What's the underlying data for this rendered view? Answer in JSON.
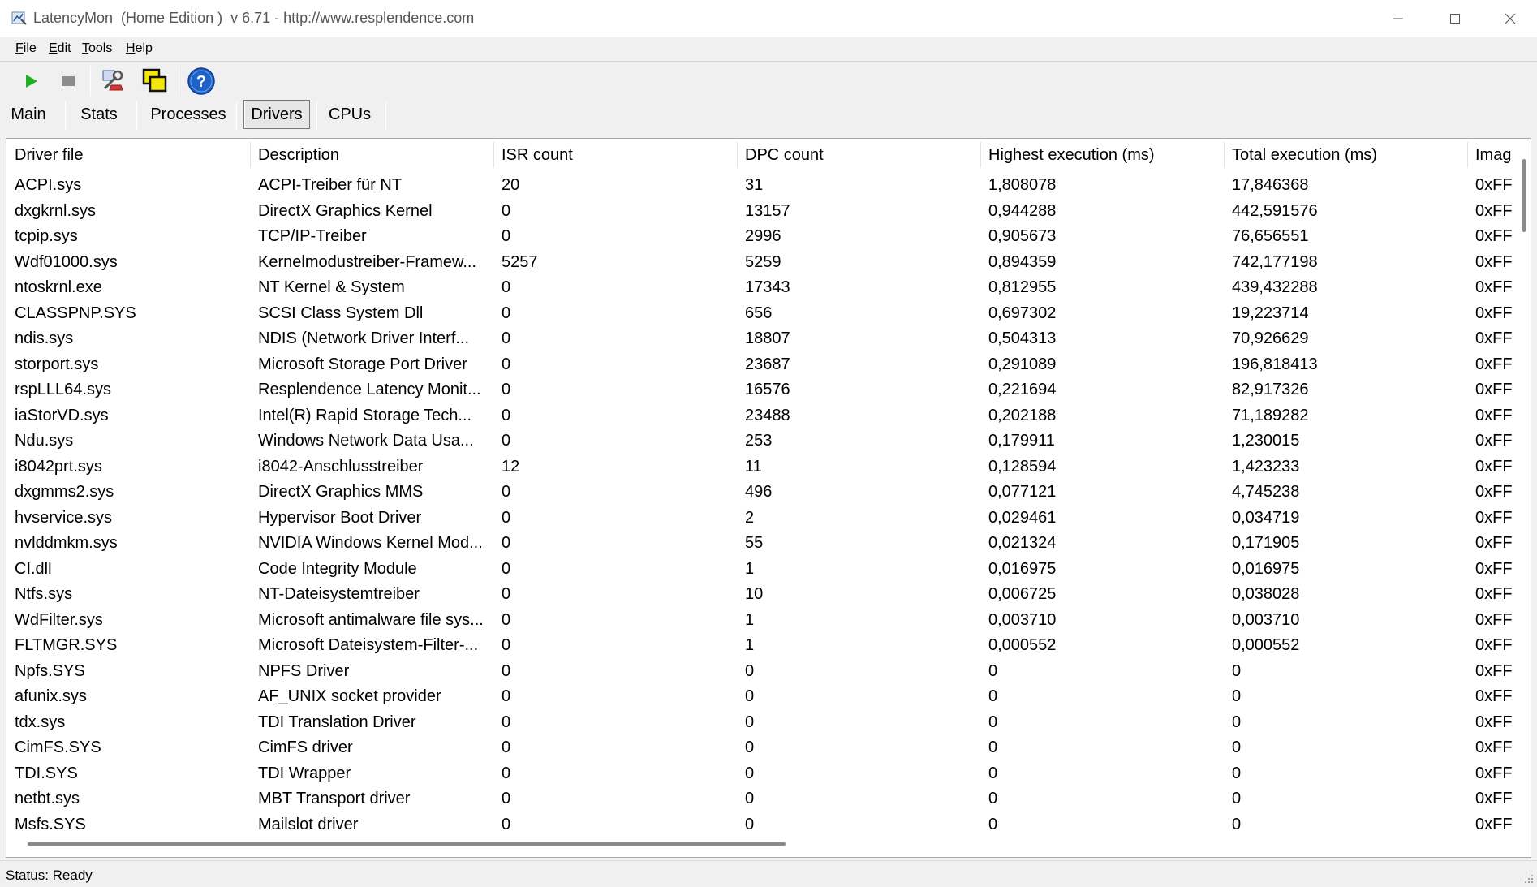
{
  "window": {
    "title": "LatencyMon  (Home Edition )  v 6.71 - http://www.resplendence.com"
  },
  "menu": [
    {
      "label": "File"
    },
    {
      "label": "Edit"
    },
    {
      "label": "Tools"
    },
    {
      "label": "Help"
    }
  ],
  "toolbar": {
    "buttons": [
      {
        "icon": "play-icon",
        "color": "#22b022"
      },
      {
        "icon": "stop-icon",
        "color": "#8c8c8c"
      },
      {
        "icon": "tools-icon"
      },
      {
        "icon": "windows-icon"
      },
      {
        "icon": "help-icon",
        "color": "#1e62c8"
      }
    ]
  },
  "tabs": [
    {
      "label": "Main",
      "active": false
    },
    {
      "label": "Stats",
      "active": false
    },
    {
      "label": "Processes",
      "active": false
    },
    {
      "label": "Drivers",
      "active": true
    },
    {
      "label": "CPUs",
      "active": false
    }
  ],
  "table": {
    "columns": [
      "Driver file",
      "Description",
      "ISR count",
      "DPC count",
      "Highest execution (ms)",
      "Total execution (ms)",
      "Imag"
    ],
    "rows": [
      [
        "ACPI.sys",
        "ACPI-Treiber für NT",
        "20",
        "31",
        "1,808078",
        "17,846368",
        "0xFF"
      ],
      [
        "dxgkrnl.sys",
        "DirectX Graphics Kernel",
        "0",
        "13157",
        "0,944288",
        "442,591576",
        "0xFF"
      ],
      [
        "tcpip.sys",
        "TCP/IP-Treiber",
        "0",
        "2996",
        "0,905673",
        "76,656551",
        "0xFF"
      ],
      [
        "Wdf01000.sys",
        "Kernelmodustreiber-Framew...",
        "5257",
        "5259",
        "0,894359",
        "742,177198",
        "0xFF"
      ],
      [
        "ntoskrnl.exe",
        "NT Kernel & System",
        "0",
        "17343",
        "0,812955",
        "439,432288",
        "0xFF"
      ],
      [
        "CLASSPNP.SYS",
        "SCSI Class System Dll",
        "0",
        "656",
        "0,697302",
        "19,223714",
        "0xFF"
      ],
      [
        "ndis.sys",
        "NDIS (Network Driver Interf...",
        "0",
        "18807",
        "0,504313",
        "70,926629",
        "0xFF"
      ],
      [
        "storport.sys",
        "Microsoft Storage Port Driver",
        "0",
        "23687",
        "0,291089",
        "196,818413",
        "0xFF"
      ],
      [
        "rspLLL64.sys",
        "Resplendence Latency Monit...",
        "0",
        "16576",
        "0,221694",
        "82,917326",
        "0xFF"
      ],
      [
        "iaStorVD.sys",
        "Intel(R) Rapid Storage Tech...",
        "0",
        "23488",
        "0,202188",
        "71,189282",
        "0xFF"
      ],
      [
        "Ndu.sys",
        "Windows Network Data Usa...",
        "0",
        "253",
        "0,179911",
        "1,230015",
        "0xFF"
      ],
      [
        "i8042prt.sys",
        "i8042-Anschlusstreiber",
        "12",
        "11",
        "0,128594",
        "1,423233",
        "0xFF"
      ],
      [
        "dxgmms2.sys",
        "DirectX Graphics MMS",
        "0",
        "496",
        "0,077121",
        "4,745238",
        "0xFF"
      ],
      [
        "hvservice.sys",
        "Hypervisor Boot Driver",
        "0",
        "2",
        "0,029461",
        "0,034719",
        "0xFF"
      ],
      [
        "nvlddmkm.sys",
        "NVIDIA Windows Kernel Mod...",
        "0",
        "55",
        "0,021324",
        "0,171905",
        "0xFF"
      ],
      [
        "CI.dll",
        "Code Integrity Module",
        "0",
        "1",
        "0,016975",
        "0,016975",
        "0xFF"
      ],
      [
        "Ntfs.sys",
        "NT-Dateisystemtreiber",
        "0",
        "10",
        "0,006725",
        "0,038028",
        "0xFF"
      ],
      [
        "WdFilter.sys",
        "Microsoft antimalware file sys...",
        "0",
        "1",
        "0,003710",
        "0,003710",
        "0xFF"
      ],
      [
        "FLTMGR.SYS",
        "Microsoft Dateisystem-Filter-...",
        "0",
        "1",
        "0,000552",
        "0,000552",
        "0xFF"
      ],
      [
        "Npfs.SYS",
        "NPFS Driver",
        "0",
        "0",
        "0",
        "0",
        "0xFF"
      ],
      [
        "afunix.sys",
        "AF_UNIX socket provider",
        "0",
        "0",
        "0",
        "0",
        "0xFF"
      ],
      [
        "tdx.sys",
        "TDI Translation Driver",
        "0",
        "0",
        "0",
        "0",
        "0xFF"
      ],
      [
        "CimFS.SYS",
        "CimFS driver",
        "0",
        "0",
        "0",
        "0",
        "0xFF"
      ],
      [
        "TDI.SYS",
        "TDI Wrapper",
        "0",
        "0",
        "0",
        "0",
        "0xFF"
      ],
      [
        "netbt.sys",
        "MBT Transport driver",
        "0",
        "0",
        "0",
        "0",
        "0xFF"
      ],
      [
        "Msfs.SYS",
        "Mailslot driver",
        "0",
        "0",
        "0",
        "0",
        "0xFF"
      ]
    ]
  },
  "status": {
    "text": "Status: Ready"
  }
}
